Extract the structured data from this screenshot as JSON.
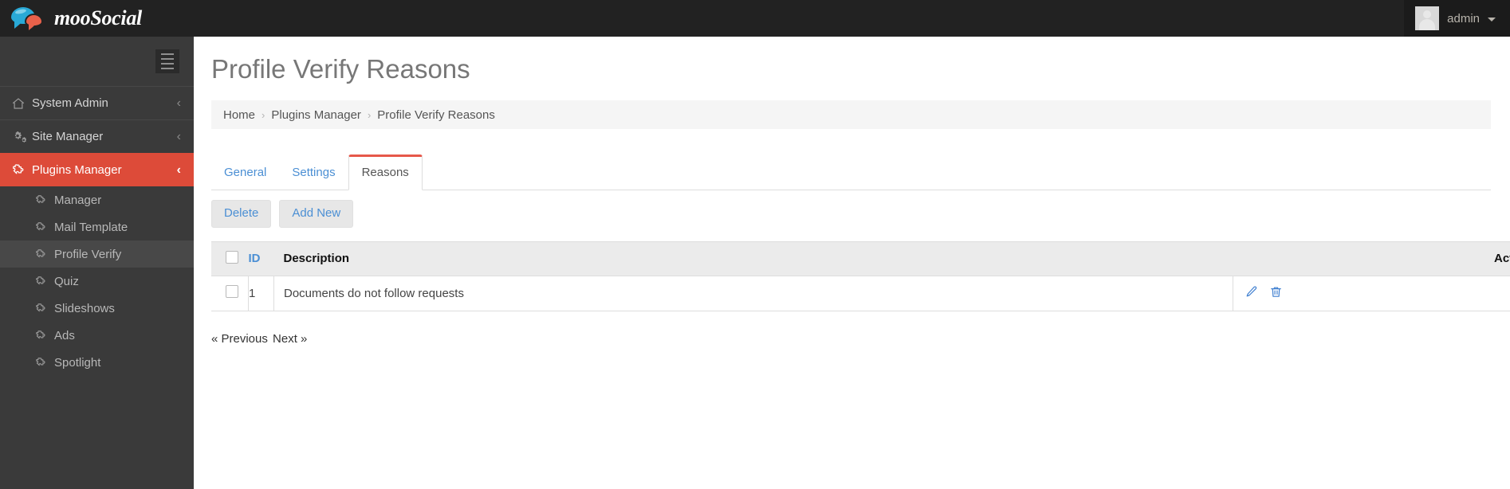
{
  "topbar": {
    "brand": "mooSocial",
    "logo_icon": "speech-bubbles-icon",
    "logo_colors": {
      "blue": "#29a9d6",
      "orange": "#e8614a"
    },
    "user": {
      "name": "admin",
      "avatar_icon": "user-avatar-placeholder-icon",
      "caret_icon": "chevron-down-icon"
    }
  },
  "sidebar": {
    "toggle_icon": "hamburger-menu-icon",
    "accent_color": "#dd4b39",
    "items": [
      {
        "label": "System Admin",
        "icon": "home-icon",
        "chevron": "‹",
        "active": false
      },
      {
        "label": "Site Manager",
        "icon": "gears-icon",
        "chevron": "‹",
        "active": false
      },
      {
        "label": "Plugins Manager",
        "icon": "puzzle-piece-icon",
        "chevron": "‹",
        "active": true
      }
    ],
    "subitems": [
      {
        "label": "Manager",
        "icon": "puzzle-piece-icon",
        "current": false
      },
      {
        "label": "Mail Template",
        "icon": "puzzle-piece-icon",
        "current": false
      },
      {
        "label": "Profile Verify",
        "icon": "puzzle-piece-icon",
        "current": true
      },
      {
        "label": "Quiz",
        "icon": "puzzle-piece-icon",
        "current": false
      },
      {
        "label": "Slideshows",
        "icon": "puzzle-piece-icon",
        "current": false
      },
      {
        "label": "Ads",
        "icon": "puzzle-piece-icon",
        "current": false
      },
      {
        "label": "Spotlight",
        "icon": "puzzle-piece-icon",
        "current": false
      }
    ]
  },
  "main": {
    "page_title": "Profile Verify Reasons",
    "breadcrumb": [
      {
        "label": "Home"
      },
      {
        "label": "Plugins Manager"
      },
      {
        "label": "Profile Verify Reasons"
      }
    ],
    "breadcrumb_separator": "›",
    "tabs": [
      {
        "label": "General",
        "active": false
      },
      {
        "label": "Settings",
        "active": false
      },
      {
        "label": "Reasons",
        "active": true
      }
    ],
    "tab_accent_color": "#e6584a",
    "buttons": [
      {
        "label": "Delete",
        "name": "delete-button"
      },
      {
        "label": "Add New",
        "name": "add-new-button"
      }
    ],
    "table": {
      "columns": {
        "select_all": "",
        "id": "ID",
        "description": "Description",
        "actions": "Actions"
      },
      "rows": [
        {
          "id": "1",
          "description": "Documents do not follow requests",
          "actions": [
            "edit-icon",
            "trash-icon"
          ]
        }
      ]
    },
    "pagination": {
      "previous": "« Previous",
      "next": "Next »"
    }
  }
}
